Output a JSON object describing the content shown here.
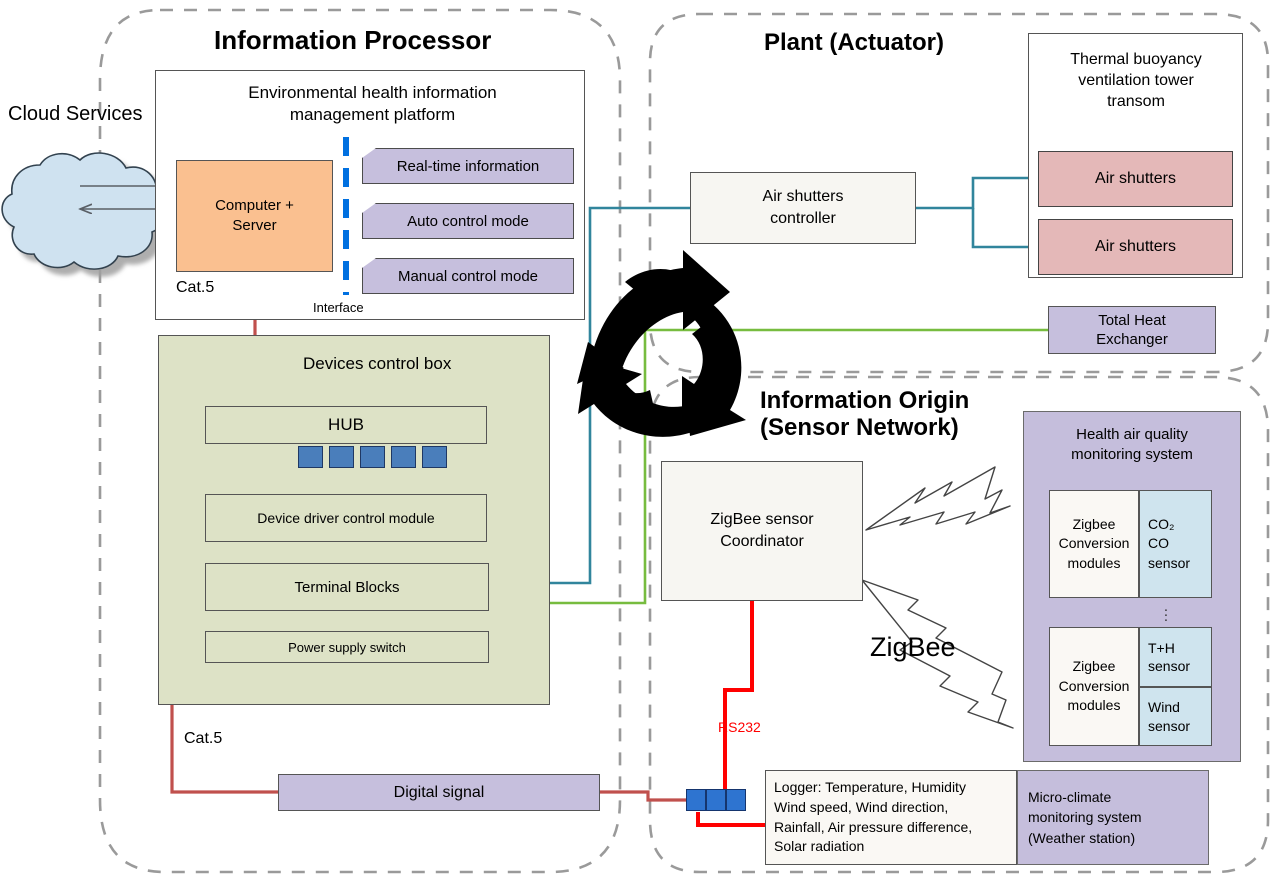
{
  "regions": {
    "information_processor": {
      "title": "Information Processor"
    },
    "plant": {
      "title": "Plant (Actuator)"
    },
    "information_origin": {
      "title": "Information Origin\n(Sensor Network)"
    }
  },
  "cloud": {
    "label": "Cloud Services"
  },
  "processor": {
    "platform_title": "Environmental health information\nmanagement platform",
    "computer_server": "Computer +\nServer",
    "cat5_top": "Cat.5",
    "interface_label": "Interface",
    "banners": [
      {
        "label": "Real-time information"
      },
      {
        "label": "Auto control mode"
      },
      {
        "label": "Manual control mode"
      }
    ],
    "devices_box_title": "Devices control box",
    "hub": "HUB",
    "hub_port_count": 5,
    "device_driver": "Device driver control module",
    "terminal_blocks": "Terminal Blocks",
    "power_supply": "Power supply switch",
    "cat5_bottom": "Cat.5",
    "digital_signal": "Digital signal"
  },
  "plant": {
    "tower_title": "Thermal buoyancy\nventilation tower\ntransom",
    "air_shutters_controller": "Air shutters\ncontroller",
    "air_shutters_1": "Air shutters",
    "air_shutters_2": "Air shutters",
    "total_heat_exchanger": "Total Heat\nExchanger"
  },
  "origin": {
    "coordinator": "ZigBee sensor\nCoordinator",
    "zigbee_label": "ZigBee",
    "rs232_label": "RS232",
    "rs232_port_count": 3,
    "air_quality": {
      "title": "Health air quality\nmonitoring system",
      "modules": [
        {
          "left": "Zigbee\nConversion\nmodules",
          "sensors": [
            "CO₂\nCO\nsensor"
          ]
        },
        {
          "left": "Zigbee\nConversion\nmodules",
          "sensors": [
            "T+H\nsensor",
            "Wind\nsensor"
          ]
        }
      ]
    },
    "weather": {
      "logger": "Logger: Temperature, Humidity\nWind speed, Wind direction,\nRainfall, Air pressure difference,\nSolar radiation",
      "system": "Micro-climate\nmonitoring  system\n(Weather station)"
    }
  },
  "colors": {
    "orange": "#fac090",
    "purple": "#c6bfdd",
    "green_panel": "#dde2c6",
    "pink": "#e4b8b8",
    "light_blue": "#cfe4ee",
    "port_blue": "#4a7ebb",
    "wire_red_dark": "#c0504d",
    "wire_red_bright": "#ff0000",
    "wire_teal": "#31859c",
    "wire_green": "#77bc3f",
    "wire_blue": "#0070e0",
    "cloud_fill": "#cfe2f0",
    "dashed_region": "#9a9a9a"
  }
}
